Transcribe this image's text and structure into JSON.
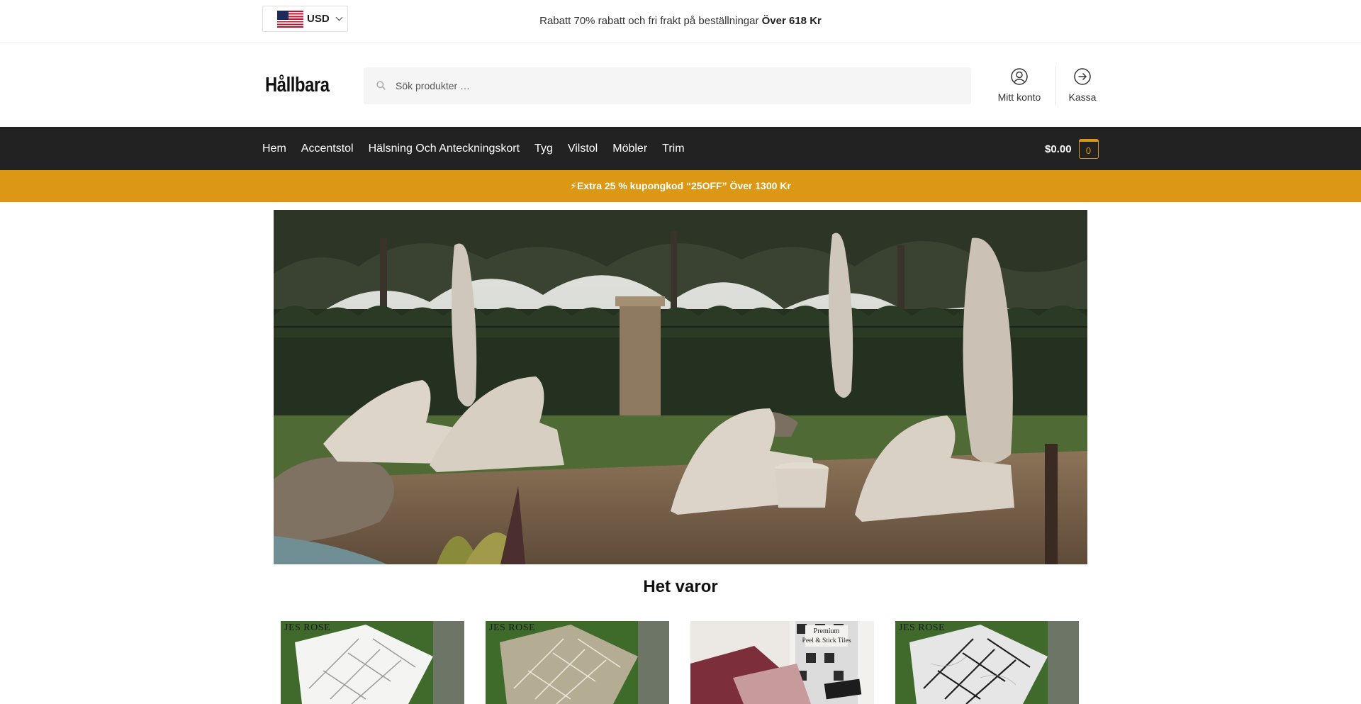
{
  "topbar": {
    "currency": "USD",
    "promo_text": "Rabatt 70% rabatt och fri frakt på beställningar ",
    "promo_bold": "Över 618 Kr"
  },
  "header": {
    "logo": "Hållbara",
    "search_placeholder": "Sök produkter …",
    "account_label": "Mitt konto",
    "checkout_label": "Kassa"
  },
  "nav": {
    "items": [
      "Hem",
      "Accentstol",
      "Hälsning Och Anteckningskort",
      "Tyg",
      "Vilstol",
      "Möbler",
      "Trim"
    ],
    "cart_total": "$0.00",
    "cart_count": "0"
  },
  "coupon": {
    "text": "⚡Extra 25 % kupongkod “25OFF” Över 1300 Kr"
  },
  "section": {
    "title": "Het varor"
  },
  "products": [
    {
      "brand": "JES ROSE"
    },
    {
      "brand": "JES ROSE"
    },
    {
      "brand": ""
    },
    {
      "brand": "JES ROSE"
    }
  ],
  "colors": {
    "nav_bg": "#222222",
    "accent": "#dc9814"
  },
  "icons": [
    "us-flag-icon",
    "chevron-down-icon",
    "search-icon",
    "user-icon",
    "arrow-right-circle-icon"
  ]
}
